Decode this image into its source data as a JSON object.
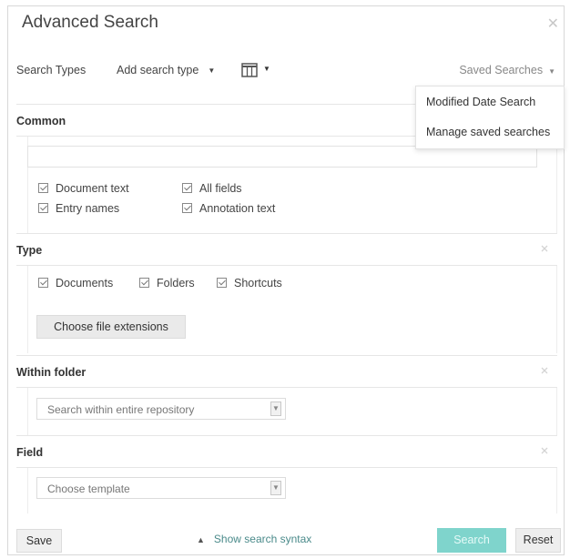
{
  "dialog": {
    "title": "Advanced Search"
  },
  "toolbar": {
    "search_types_label": "Search Types",
    "add_search_type": "Add search type",
    "saved_searches": "Saved Searches"
  },
  "saved_menu": {
    "items": [
      "Modified Date Search",
      "Manage saved searches"
    ]
  },
  "common": {
    "header": "Common",
    "search_value": "",
    "checkboxes": [
      "Document text",
      "All fields",
      "Entry names",
      "Annotation text"
    ]
  },
  "type": {
    "header": "Type",
    "checkboxes": [
      "Documents",
      "Folders",
      "Shortcuts"
    ],
    "choose_extensions": "Choose file extensions"
  },
  "within_folder": {
    "header": "Within folder",
    "select_value": "Search within entire repository"
  },
  "field": {
    "header": "Field",
    "select_value": "Choose template"
  },
  "footer": {
    "save": "Save",
    "show_syntax": "Show search syntax",
    "search": "Search",
    "reset": "Reset"
  },
  "colors": {
    "accent": "#7fd4cc",
    "link": "#4a8a8a"
  },
  "icons": {
    "close": "close-icon",
    "columns": "columns-icon",
    "collapse": "collapse-icon",
    "chevron_up": "chevron-up-icon",
    "checkbox": "checkbox-checked-icon"
  }
}
